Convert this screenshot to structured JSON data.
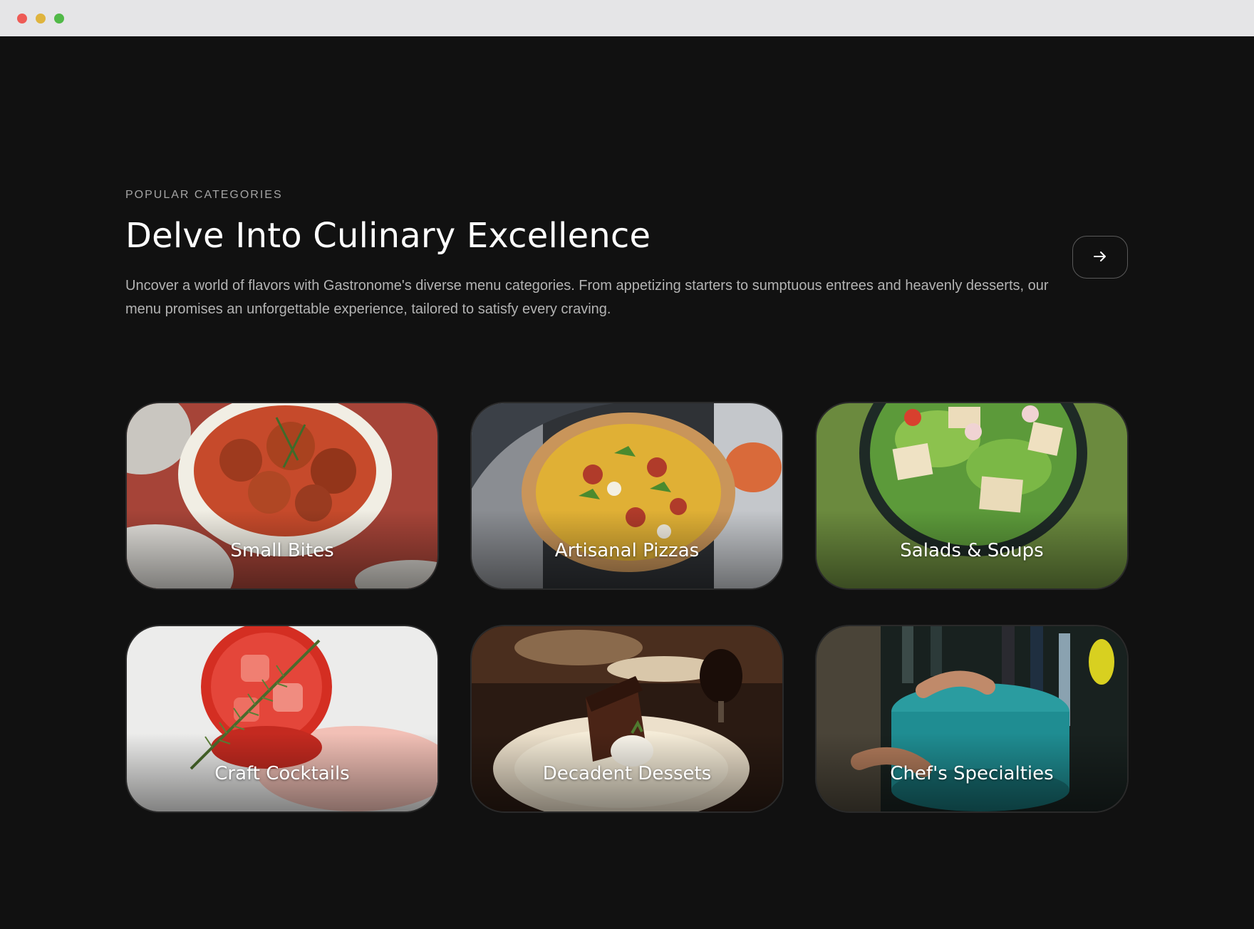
{
  "section": {
    "eyebrow": "POPULAR CATEGORIES",
    "title": "Delve Into Culinary Excellence",
    "description": "Uncover a world of flavors with Gastronome's diverse menu categories. From appetizing starters to sumptuous entrees and heavenly desserts, our menu promises an unforgettable experience, tailored to satisfy every craving.",
    "next_icon": "arrow-right-icon"
  },
  "categories": [
    {
      "label": "Small Bites",
      "image": "meatballs-in-bowl"
    },
    {
      "label": "Artisanal Pizzas",
      "image": "pizza-in-oven"
    },
    {
      "label": "Salads & Soups",
      "image": "salad-bowl"
    },
    {
      "label": "Craft Cocktails",
      "image": "red-cocktail-with-rosemary"
    },
    {
      "label": "Decadent Dessets",
      "image": "chocolate-cake-slice"
    },
    {
      "label": "Chef's Specialties",
      "image": "teal-dutch-oven"
    }
  ],
  "colors": {
    "background": "#111111",
    "text": "#ffffff",
    "muted": "#b3b3b3"
  }
}
